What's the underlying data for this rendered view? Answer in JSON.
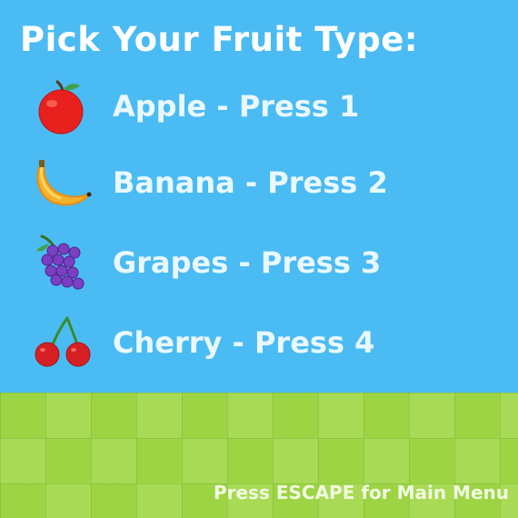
{
  "title": "Pick Your Fruit Type:",
  "options": [
    {
      "label": "Apple - Press 1",
      "icon": "apple-icon",
      "key": "1"
    },
    {
      "label": "Banana - Press 2",
      "icon": "banana-icon",
      "key": "2"
    },
    {
      "label": "Grapes - Press 3",
      "icon": "grapes-icon",
      "key": "3"
    },
    {
      "label": "Cherry - Press 4",
      "icon": "cherry-icon",
      "key": "4"
    }
  ],
  "footer": {
    "escape_hint": "Press ESCAPE for Main Menu"
  },
  "colors": {
    "sky": "#4BBBF4",
    "ground_light": "#A8DA55",
    "ground_dark": "#9CD444",
    "title_text": "#FFFFFF",
    "option_text": "#E9F8FF"
  }
}
